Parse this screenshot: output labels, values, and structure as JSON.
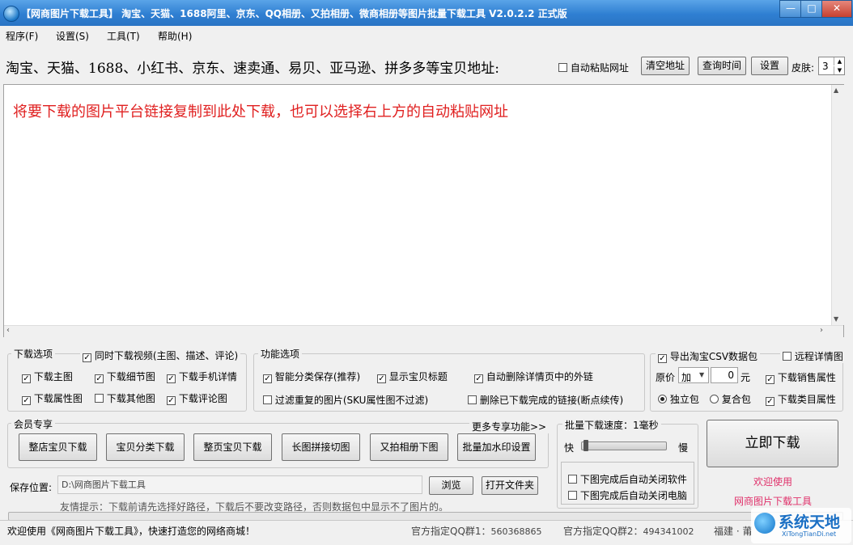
{
  "window": {
    "title": "【网商图片下载工具】 淘宝、天猫、1688阿里、京东、QQ相册、又拍相册、微商相册等图片批量下载工具 V2.0.2.2 正式版",
    "min": "—",
    "max": "□",
    "close": "✕"
  },
  "menu": [
    "程序(F)",
    "设置(S)",
    "工具(T)",
    "帮助(H)"
  ],
  "url_row": {
    "label": "淘宝、天猫、1688、小红书、京东、速卖通、易贝、亚马逊、拼多多等宝贝地址:",
    "auto_paste": "自动粘贴网址",
    "clear": "清空地址",
    "query_time": "查询时间",
    "settings": "设置",
    "skin_label": "皮肤:",
    "skin_value": "3"
  },
  "link_area": {
    "hint": "将要下载的图片平台链接复制到此处下载，也可以选择右上方的自动粘贴网址"
  },
  "download_options": {
    "title": "下载选项",
    "video": "同时下载视频(主图、描述、评论)",
    "items": [
      {
        "label": "下载主图",
        "checked": true
      },
      {
        "label": "下载细节图",
        "checked": true
      },
      {
        "label": "下载手机详情",
        "checked": true
      },
      {
        "label": "下载属性图",
        "checked": true
      },
      {
        "label": "下载其他图",
        "checked": false
      },
      {
        "label": "下载评论图",
        "checked": true
      }
    ]
  },
  "function_options": {
    "title": "功能选项",
    "items": [
      {
        "label": "智能分类保存(推荐)",
        "checked": true
      },
      {
        "label": "显示宝贝标题",
        "checked": true
      },
      {
        "label": "自动删除详情页中的外链",
        "checked": true
      },
      {
        "label": "过滤重复的图片(SKU属性图不过滤)",
        "checked": false
      },
      {
        "label": "删除已下载完成的链接(断点续传)",
        "checked": false
      }
    ]
  },
  "csv": {
    "export": "导出淘宝CSV数据包",
    "remote": "远程详情图",
    "price_label": "原价",
    "price_op": "加",
    "price_value": "0",
    "unit": "元",
    "sales_attr": "下载销售属性",
    "standalone": "独立包",
    "combined": "复合包",
    "category_attr": "下载类目属性"
  },
  "member": {
    "title": "会员专享",
    "more": "更多专享功能>>",
    "buttons": [
      "整店宝贝下载",
      "宝贝分类下载",
      "整页宝贝下载",
      "长图拼接切图",
      "又拍相册下图",
      "批量加水印设置"
    ]
  },
  "speed": {
    "title": "批量下载速度：1毫秒",
    "fast": "快",
    "slow": "慢",
    "close_app": "下图完成后自动关闭软件",
    "shutdown": "下图完成后自动关闭电脑"
  },
  "start": {
    "button": "立即下载",
    "welcome1": "欢迎使用",
    "welcome2": "网商图片下载工具"
  },
  "save": {
    "label": "保存位置:",
    "path": "D:\\网商图片下载工具",
    "browse": "浏览",
    "open_folder": "打开文件夹",
    "tip": "友情提示：下载前请先选择好路径，下载后不要改变路径，否则数据包中显示不了图片的。"
  },
  "status": {
    "welcome": "欢迎使用《网商图片下载工具》，快速打造您的网络商城！",
    "qq1_label": "官方指定QQ群1：",
    "qq1": "560368865",
    "qq2_label": "官方指定QQ群2：",
    "qq2": "494341002",
    "location": "福建 · 莆",
    "brand": "系统天地",
    "brand_url": "XiTongTianDi.net"
  }
}
